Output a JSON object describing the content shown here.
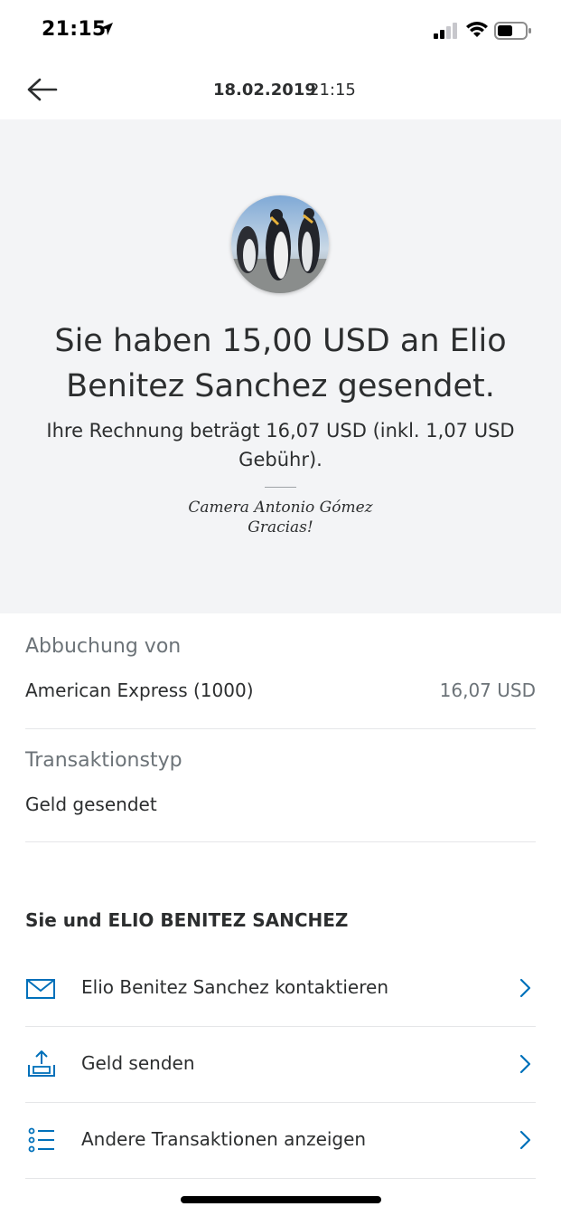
{
  "status_bar": {
    "time": "21:15",
    "location_icon": "location-arrow-icon",
    "signal_icon": "cellular-signal-icon",
    "wifi_icon": "wifi-icon",
    "battery_icon": "battery-icon"
  },
  "header": {
    "back_icon": "arrow-left-icon",
    "date": "18.02.2019",
    "time": "21:15"
  },
  "hero": {
    "avatar_description": "penguins photo",
    "title": "Sie haben 15,00 USD an Elio Benitez Sanchez gesendet.",
    "subtitle": "Ihre Rechnung beträgt 16,07 USD (inkl. 1,07 USD Gebühr).",
    "note_line1": "Camera Antonio Gómez",
    "note_line2": "Gracias!"
  },
  "details": {
    "funding_label": "Abbuchung von",
    "funding_source": "American Express (1000)",
    "funding_amount": "16,07 USD",
    "type_label": "Transaktionstyp",
    "type_value": "Geld gesendet"
  },
  "relationship": {
    "title": "Sie und ELIO BENITEZ SANCHEZ",
    "actions": [
      {
        "label": "Elio Benitez Sanchez kontaktieren",
        "icon": "envelope-icon"
      },
      {
        "label": "Geld senden",
        "icon": "send-money-icon"
      },
      {
        "label": "Andere Transaktionen anzeigen",
        "icon": "list-icon"
      }
    ]
  },
  "colors": {
    "accent": "#0070ba",
    "hero_background": "#f3f4f6",
    "text_primary": "#2c2e2f",
    "text_secondary": "#6c7378"
  }
}
